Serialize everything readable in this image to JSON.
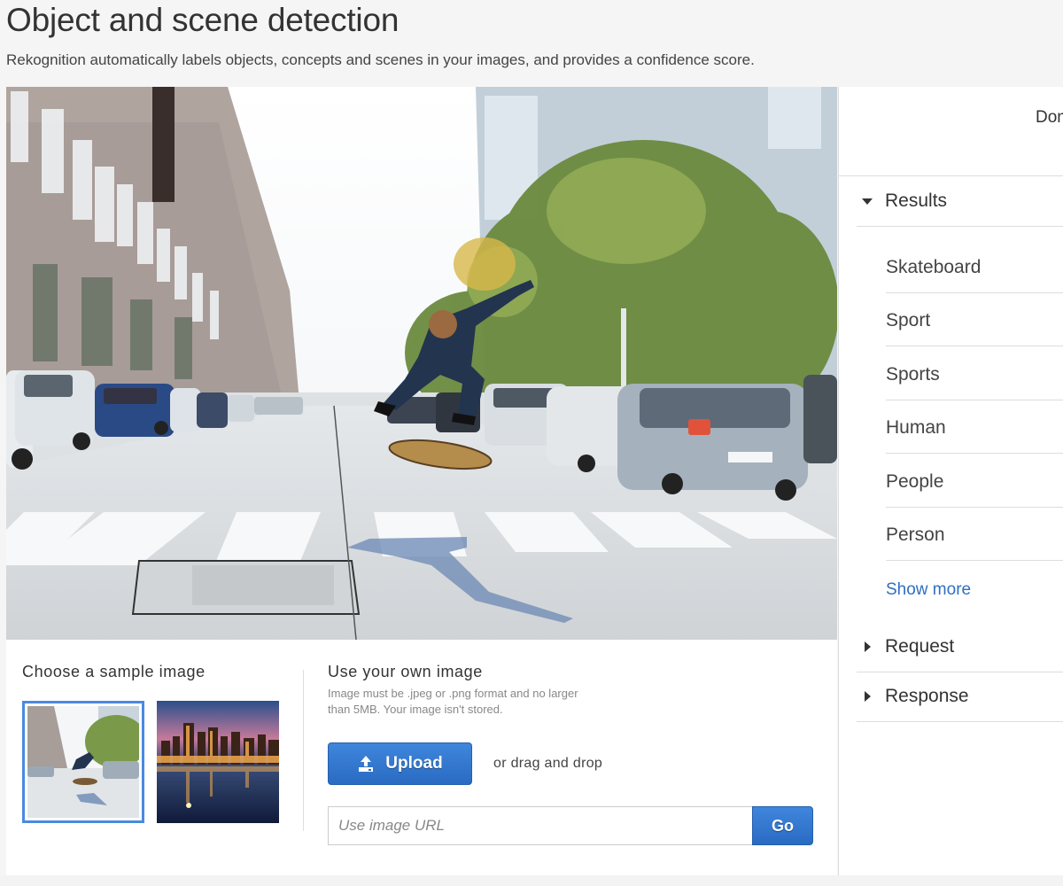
{
  "header": {
    "title": "Object and scene detection",
    "subtitle": "Rekognition automatically labels objects, concepts and scenes in your images, and provides a confidence score."
  },
  "image": {
    "alt": "Skateboarder jumping over street crosswalk with parked cars and trees"
  },
  "sample": {
    "heading": "Choose a sample image",
    "images": [
      {
        "name": "skateboarder-street",
        "selected": true
      },
      {
        "name": "city-skyline-night",
        "selected": false
      }
    ]
  },
  "own_image": {
    "heading": "Use your own image",
    "help": "Image must be .jpeg or .png format and no larger than 5MB. Your image isn't stored.",
    "upload_label": "Upload",
    "upload_icon": "upload-icon",
    "drag_text": "or drag and drop",
    "url_placeholder": "Use image URL",
    "url_value": "",
    "go_label": "Go"
  },
  "results_panel": {
    "done_label": "Done",
    "results_heading": "Results",
    "labels": [
      "Skateboard",
      "Sport",
      "Sports",
      "Human",
      "People",
      "Person"
    ],
    "show_more": "Show more",
    "request_heading": "Request",
    "response_heading": "Response"
  },
  "colors": {
    "accent_blue": "#2f6fc2",
    "button_blue": "#3278d0",
    "selected_border": "#4a8ae0"
  }
}
